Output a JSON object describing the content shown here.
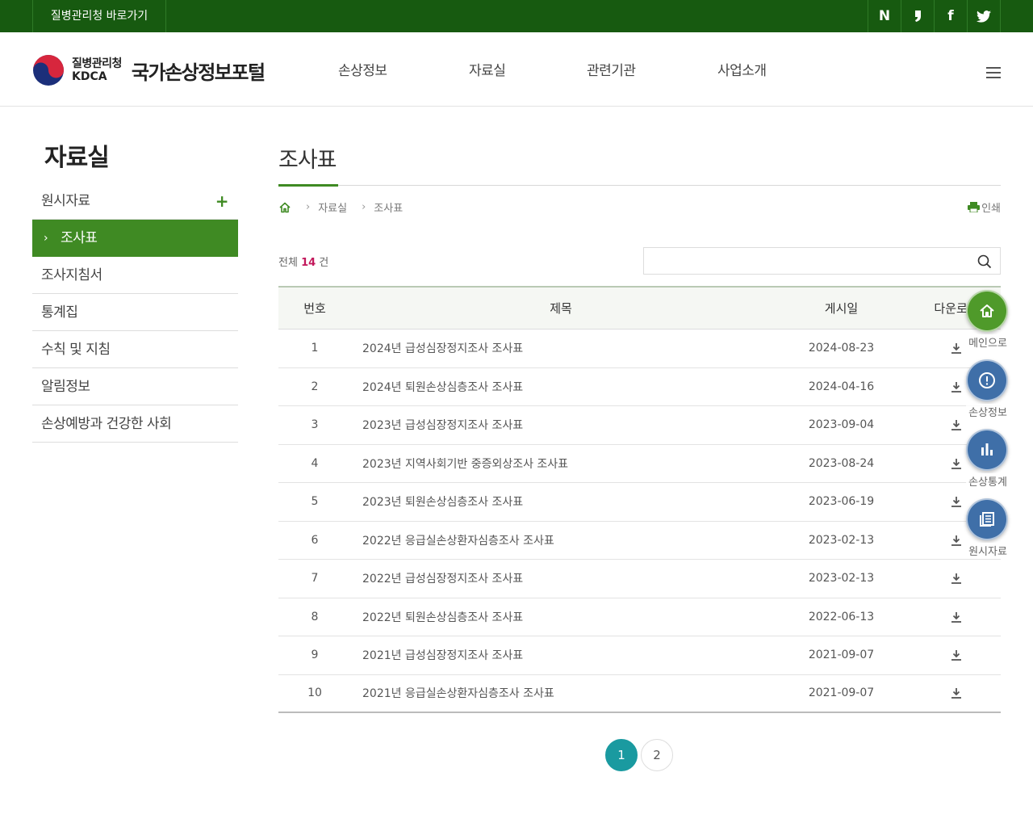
{
  "topbar": {
    "quick_link": "질병관리청 바로가기",
    "sns": [
      {
        "name": "naver-blog",
        "glyph": "N"
      },
      {
        "name": "naver-post",
        "glyph": "❜"
      },
      {
        "name": "facebook",
        "glyph": "f"
      },
      {
        "name": "twitter",
        "glyph": "🐦"
      }
    ]
  },
  "header": {
    "org_korean": "질병관리청",
    "org_english": "KDCA",
    "portal_name": "국가손상정보포털",
    "nav": [
      "손상정보",
      "자료실",
      "관련기관",
      "사업소개"
    ]
  },
  "sidebar": {
    "title": "자료실",
    "items": [
      {
        "label": "원시자료",
        "has_plus": true
      },
      {
        "label": "조사표",
        "active": true
      },
      {
        "label": "조사지침서"
      },
      {
        "label": "통계집"
      },
      {
        "label": "수칙 및 지침"
      },
      {
        "label": "알림정보"
      },
      {
        "label": "손상예방과 건강한 사회"
      }
    ]
  },
  "main": {
    "title": "조사표",
    "breadcrumb": [
      "자료실",
      "조사표"
    ],
    "print_label": "인쇄",
    "total_prefix": "전체",
    "total_count": "14",
    "total_suffix": "건",
    "search": {
      "value": "",
      "placeholder": ""
    },
    "table": {
      "headers": [
        "번호",
        "제목",
        "게시일",
        "다운로드"
      ],
      "rows": [
        {
          "no": "1",
          "title": "2024년 급성심장정지조사 조사표",
          "date": "2024-08-23"
        },
        {
          "no": "2",
          "title": "2024년 퇴원손상심층조사 조사표",
          "date": "2024-04-16"
        },
        {
          "no": "3",
          "title": "2023년 급성심장정지조사 조사표",
          "date": "2023-09-04"
        },
        {
          "no": "4",
          "title": "2023년 지역사회기반 중증외상조사 조사표",
          "date": "2023-08-24"
        },
        {
          "no": "5",
          "title": "2023년 퇴원손상심층조사 조사표",
          "date": "2023-06-19"
        },
        {
          "no": "6",
          "title": "2022년 응급실손상환자심층조사 조사표",
          "date": "2023-02-13"
        },
        {
          "no": "7",
          "title": "2022년 급성심장정지조사 조사표",
          "date": "2023-02-13"
        },
        {
          "no": "8",
          "title": "2022년 퇴원손상심층조사 조사표",
          "date": "2022-06-13"
        },
        {
          "no": "9",
          "title": "2021년 급성심장정지조사 조사표",
          "date": "2021-09-07"
        },
        {
          "no": "10",
          "title": "2021년 응급실손상환자심층조사 조사표",
          "date": "2021-09-07"
        }
      ]
    },
    "pagination": [
      "1",
      "2"
    ],
    "current_page": "1"
  },
  "quick_menu": [
    {
      "label": "메인으로",
      "icon": "home-icon",
      "color": "#4f9a2a"
    },
    {
      "label": "손상정보",
      "icon": "alert-circle-icon",
      "color": "#3f6fa8"
    },
    {
      "label": "손상통계",
      "icon": "bar-chart-icon",
      "color": "#3f6fa8"
    },
    {
      "label": "원시자료",
      "icon": "document-list-icon",
      "color": "#3f6fa8"
    }
  ]
}
